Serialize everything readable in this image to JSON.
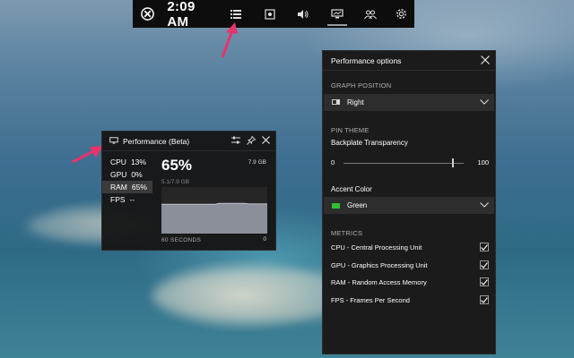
{
  "gamebar": {
    "time": "2:09 AM",
    "icons": [
      "xbox-logo-icon",
      "widget-menu-icon",
      "capture-icon",
      "audio-icon",
      "performance-icon",
      "social-icon",
      "settings-icon"
    ]
  },
  "performance_widget": {
    "title": "Performance (Beta)",
    "metrics": [
      {
        "name": "CPU",
        "value": "13%"
      },
      {
        "name": "GPU",
        "value": "0%"
      },
      {
        "name": "RAM",
        "value": "65%"
      },
      {
        "name": "FPS",
        "value": "--"
      }
    ],
    "selected_metric": "RAM",
    "big_value": "65%",
    "total": "7.9 GB",
    "used": "5.1/7.9 GB",
    "time_window": "60 SECONDS",
    "min_value": "0",
    "graph_level": 0.65
  },
  "options_panel": {
    "title": "Performance options",
    "graph_position_header": "GRAPH POSITION",
    "graph_position_value": "Right",
    "pin_theme_header": "PIN THEME",
    "transparency_label": "Backplate Transparency",
    "slider_min": "0",
    "slider_max": "100",
    "slider_value": 90,
    "accent_label": "Accent Color",
    "accent_value": "Green",
    "accent_color": "#30c030",
    "metrics_header": "METRICS",
    "metrics": [
      {
        "label": "CPU - Central Processing Unit",
        "checked": true
      },
      {
        "label": "GPU - Graphics Processing Unit",
        "checked": true
      },
      {
        "label": "RAM - Random Access Memory",
        "checked": true
      },
      {
        "label": "FPS - Frames Per Second",
        "checked": true
      }
    ]
  },
  "annotation_color": "#e8336b"
}
